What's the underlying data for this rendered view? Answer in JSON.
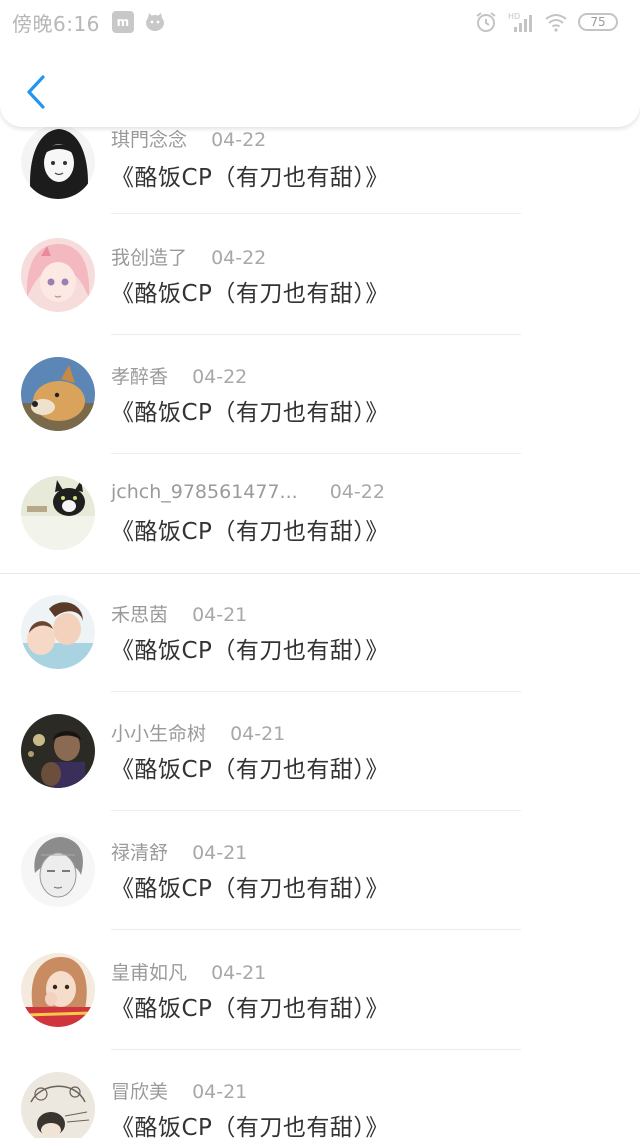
{
  "status_bar": {
    "time": "傍晚6:16",
    "network": "HD",
    "battery": "75",
    "icons": [
      "mi-icon",
      "cat-notification-icon",
      "alarm-icon",
      "signal-icon",
      "wifi-icon",
      "battery-icon"
    ]
  },
  "header": {
    "back_icon": "chevron-left-icon"
  },
  "colors": {
    "accent": "#2196f3",
    "text_primary": "#333333",
    "text_secondary": "#9e9e9e",
    "divider": "#ececec"
  },
  "list": {
    "items": [
      {
        "name": "琪門念念",
        "date": "04-22",
        "title": "《酪饭CP（有刀也有甜）》",
        "avatar": "avatar-illustrated-girl"
      },
      {
        "name": "我创造了",
        "date": "04-22",
        "title": "《酪饭CP（有刀也有甜）》",
        "avatar": "avatar-pink-anime-girl"
      },
      {
        "name": "孝醉香",
        "date": "04-22",
        "title": "《酪饭CP（有刀也有甜）》",
        "avatar": "avatar-shiba-dog"
      },
      {
        "name": "jchch_978561477...",
        "date": "04-22",
        "title": "《酪饭CP（有刀也有甜）》",
        "avatar": "avatar-cat"
      },
      {
        "name": "禾思茵",
        "date": "04-21",
        "title": "《酪饭CP（有刀也有甜）》",
        "avatar": "avatar-couple-photo"
      },
      {
        "name": "小小生命树",
        "date": "04-21",
        "title": "《酪饭CP（有刀也有甜）》",
        "avatar": "avatar-dark-photo"
      },
      {
        "name": "禄清舒",
        "date": "04-21",
        "title": "《酪饭CP（有刀也有甜）》",
        "avatar": "avatar-sketch-boy"
      },
      {
        "name": "皇甫如凡",
        "date": "04-21",
        "title": "《酪饭CP（有刀也有甜）》",
        "avatar": "avatar-girl-red"
      },
      {
        "name": "冒欣美",
        "date": "04-21",
        "title": "《酪饭CP（有刀也有甜）》",
        "avatar": "avatar-lineart"
      }
    ]
  }
}
